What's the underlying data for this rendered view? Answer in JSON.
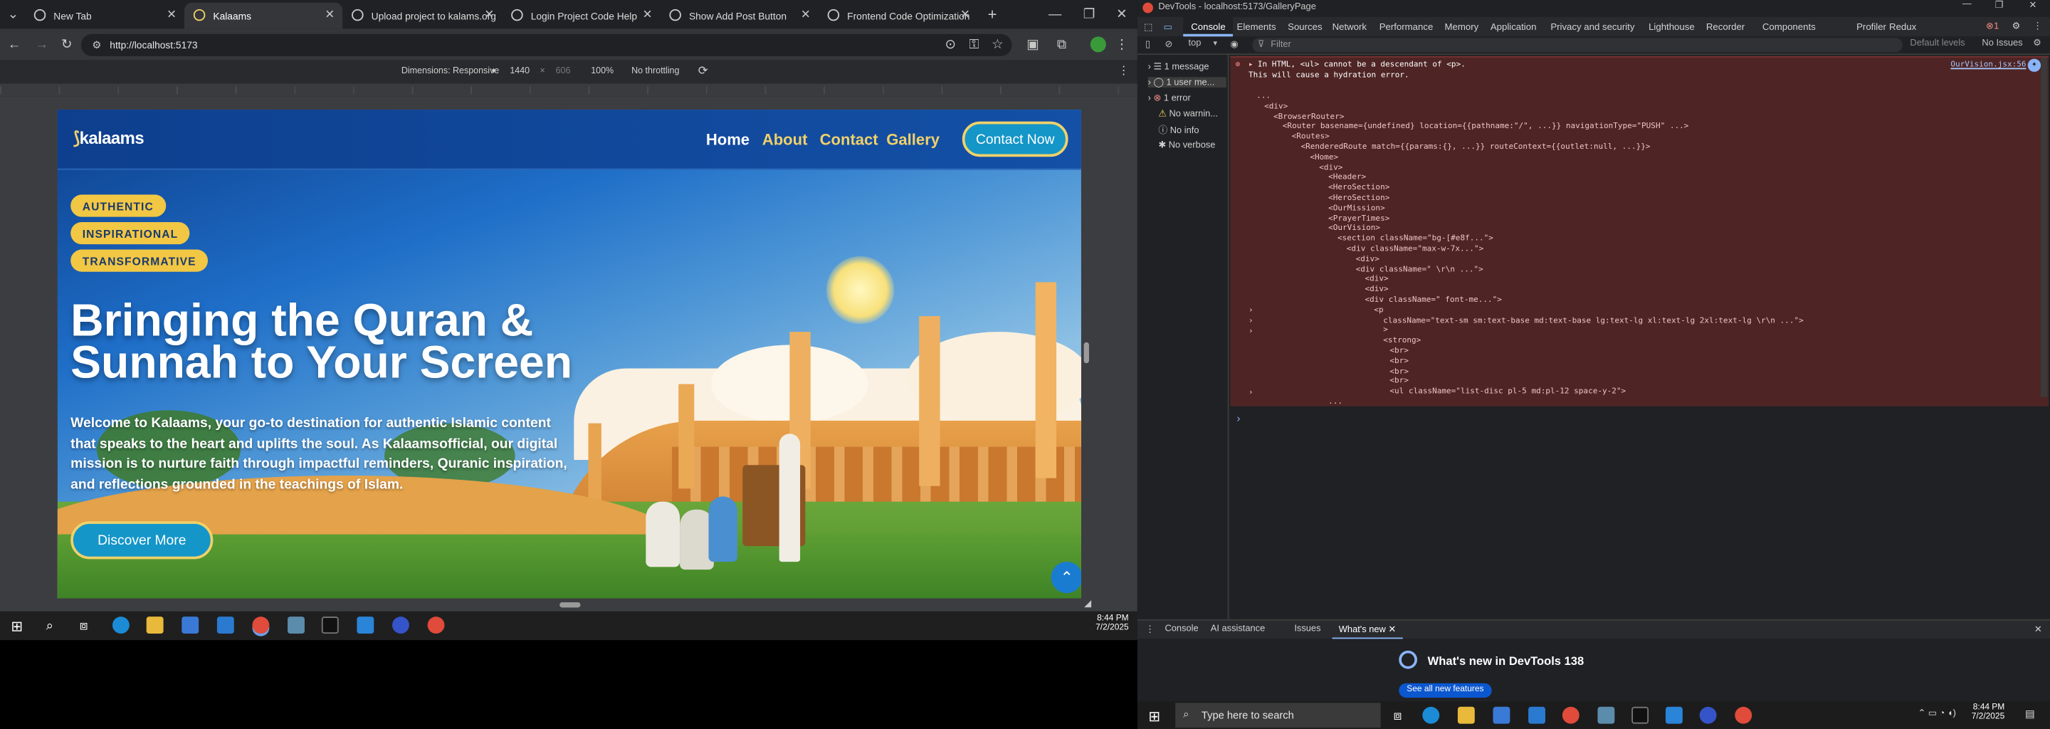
{
  "browser": {
    "tabs": [
      {
        "title": "New Tab",
        "active": false
      },
      {
        "title": "Kalaams",
        "active": true
      },
      {
        "title": "Upload project to kalams.org",
        "active": false
      },
      {
        "title": "Login Project Code Help",
        "active": false
      },
      {
        "title": "Show Add Post Button",
        "active": false
      },
      {
        "title": "Frontend Code Optimization",
        "active": false
      }
    ],
    "url": "http://localhost:5173",
    "device_toolbar": {
      "dimensions_label": "Dimensions: Responsive",
      "width": "1440",
      "height": "606",
      "zoom": "100%",
      "throttle": "No throttling"
    }
  },
  "site": {
    "logo": "kalaams",
    "nav": [
      "Home",
      "About",
      "Contact",
      "Gallery"
    ],
    "cta": "Contact Now",
    "pills": [
      "AUTHENTIC",
      "INSPIRATIONAL",
      "TRANSFORMATIVE"
    ],
    "title_line1": "Bringing the Quran &",
    "title_line2": "Sunnah to Your Screen",
    "paragraph": "Welcome to Kalaams, your go-to destination for authentic Islamic content that speaks to the heart and uplifts the soul. As Kalaamsofficial, our digital mission is to nurture faith through impactful reminders, Quranic inspiration, and reflections grounded in the teachings of Islam.",
    "discover": "Discover More"
  },
  "taskbar_left": {
    "time": "8:44 PM",
    "date": "7/2/2025"
  },
  "devtools": {
    "title": "DevTools - localhost:5173/GalleryPage",
    "tabs": [
      "Console",
      "Elements",
      "Sources",
      "Network",
      "Performance",
      "Memory",
      "Application",
      "Privacy and security",
      "Lighthouse",
      "Recorder",
      "Components",
      "Profiler",
      "Redux"
    ],
    "error_count": "1",
    "context": "top",
    "filter_placeholder": "Filter",
    "levels": "Default levels",
    "issues": "No Issues",
    "sidebar": [
      "1 message",
      "1 user me...",
      "1 error",
      "No warnin...",
      "No info",
      "No verbose"
    ],
    "error_header": "In HTML, <ul> cannot be a descendant of <p>.",
    "error_sub": "This will cause a hydration error.",
    "error_link": "OurVision.jsx:56",
    "code_lines": [
      "...",
      "<div>",
      "<BrowserRouter>",
      "<Router basename={undefined} location={{pathname:\"/\", ...}} navigationType=\"PUSH\" ...>",
      "<Routes>",
      "<RenderedRoute match={{params:{}, ...}} routeContext={{outlet:null, ...}}>",
      "<Home>",
      "<div>",
      "<Header>",
      "<HeroSection>",
      "<HeroSection>",
      "<OurMission>",
      "<PrayerTimes>",
      "<OurVision>",
      "<section className=\"bg-[#e8f...\">",
      "<div className=\"max-w-7x...\">",
      "<div>",
      "<div className=\" \\r\\n   ...\">",
      "<div>",
      "<div>",
      "<div className=\" font-me...\">",
      "<p",
      "className=\"text-sm sm:text-base md:text-base lg:text-lg xl:text-lg 2xl:text-lg \\r\\n   ...\">",
      ">",
      "<strong>",
      "<br>",
      "<br>",
      "<br>",
      "<br>",
      "<ul className=\"list-disc pl-5 md:pl-12 space-y-2\">",
      "..."
    ],
    "drawer_tabs": [
      "Console",
      "AI assistance",
      "Issues",
      "What's new"
    ],
    "whats_new": "What's new in DevTools 138",
    "see_all": "See all new features"
  },
  "taskbar_right": {
    "search_placeholder": "Type here to search",
    "time": "8:44 PM",
    "date": "7/2/2025"
  }
}
